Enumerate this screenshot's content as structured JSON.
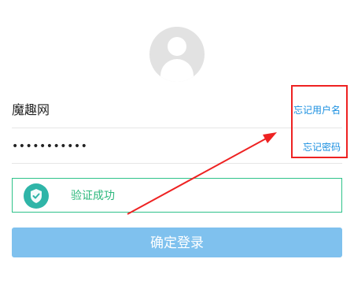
{
  "avatar_icon": "user-avatar-icon",
  "login": {
    "username_value": "魔趣网",
    "forgot_username_label": "忘记用户名",
    "password_value": "•••••••••••",
    "forgot_password_label": "忘记密码"
  },
  "verify": {
    "icon": "shield-check-icon",
    "message": "验证成功"
  },
  "submit_label": "确定登录",
  "colors": {
    "link": "#1a8fe0",
    "success": "#2db87d",
    "button": "#7fc1ee",
    "annotation": "#ee2222"
  }
}
